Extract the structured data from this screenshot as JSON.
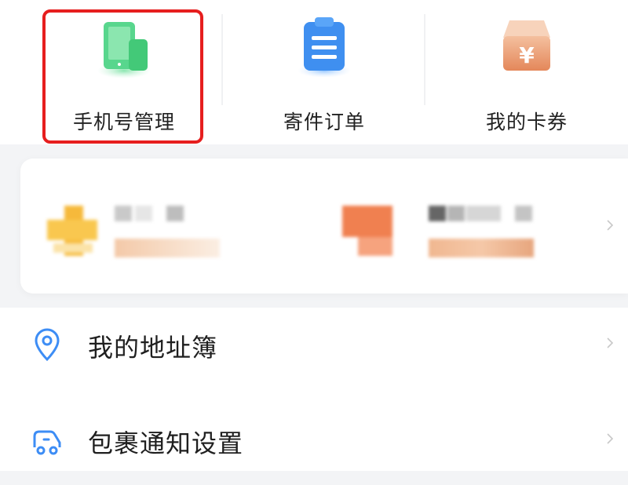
{
  "shortcuts": [
    {
      "label": "手机号管理",
      "icon": "phone-management-icon",
      "color": "#3ecf7a",
      "highlighted": true
    },
    {
      "label": "寄件订单",
      "icon": "shipping-order-icon",
      "color": "#3f8ff0",
      "highlighted": false
    },
    {
      "label": "我的卡券",
      "icon": "coupon-icon",
      "color": "#e8956a",
      "highlighted": false
    }
  ],
  "highlight_color": "#e61e1e",
  "promo": {
    "items": [
      {
        "icon": "promo-plus-icon",
        "color": "#f6b93b",
        "blurred": true
      },
      {
        "icon": "promo-block-icon",
        "color": "#f08050",
        "blurred": true
      }
    ]
  },
  "menu": {
    "items": [
      {
        "label": "我的地址簿",
        "icon": "location-pin-icon"
      },
      {
        "label": "包裹通知设置",
        "icon": "delivery-truck-icon"
      }
    ]
  }
}
